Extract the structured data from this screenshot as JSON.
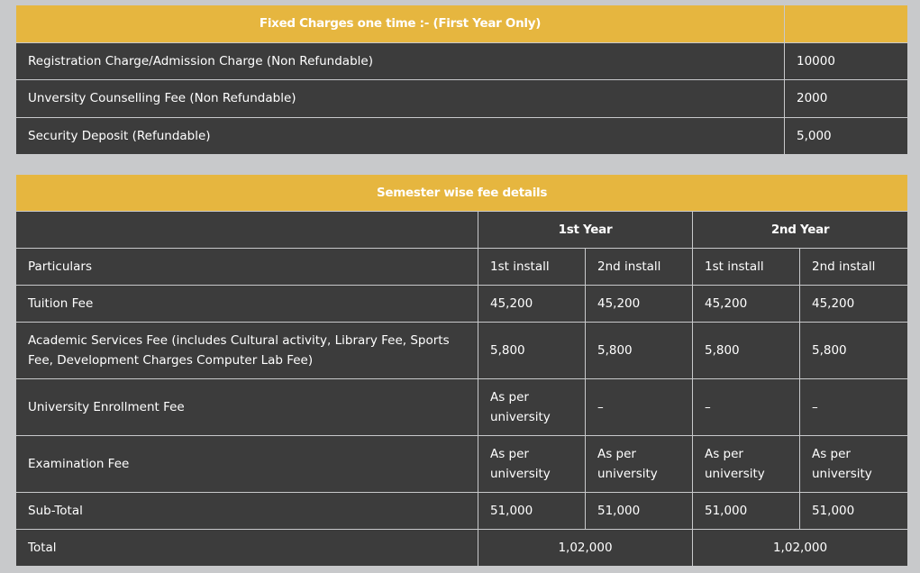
{
  "fixed": {
    "title": "Fixed Charges one time :- (First Year Only)",
    "rows": [
      {
        "label": "Registration Charge/Admission Charge (Non Refundable)",
        "value": "10000"
      },
      {
        "label": "Unversity Counselling Fee (Non Refundable)",
        "value": "2000"
      },
      {
        "label": "Security Deposit (Refundable)",
        "value": "5,000"
      }
    ]
  },
  "semester": {
    "title": "Semester wise fee details",
    "year1": "1st Year",
    "year2": "2nd Year",
    "particulars": "Particulars",
    "install1": "1st install",
    "install2": "2nd install",
    "rows": [
      {
        "label": "Tuition Fee",
        "v": [
          "45,200",
          "45,200",
          "45,200",
          "45,200"
        ]
      },
      {
        "label": "Academic Services Fee (includes Cultural activity, Library Fee, Sports Fee, Development Charges Computer Lab Fee)",
        "v": [
          "5,800",
          "5,800",
          "5,800",
          "5,800"
        ]
      },
      {
        "label": "University Enrollment Fee",
        "v": [
          "As per university",
          "–",
          "–",
          "–"
        ]
      },
      {
        "label": "Examination Fee",
        "v": [
          "As per university",
          "As per university",
          "As per university",
          "As per university"
        ]
      },
      {
        "label": "Sub-Total",
        "v": [
          "51,000",
          "51,000",
          "51,000",
          "51,000"
        ]
      }
    ],
    "total_label": "Total",
    "total_year1": "1,02,000",
    "total_year2": "1,02,000"
  }
}
